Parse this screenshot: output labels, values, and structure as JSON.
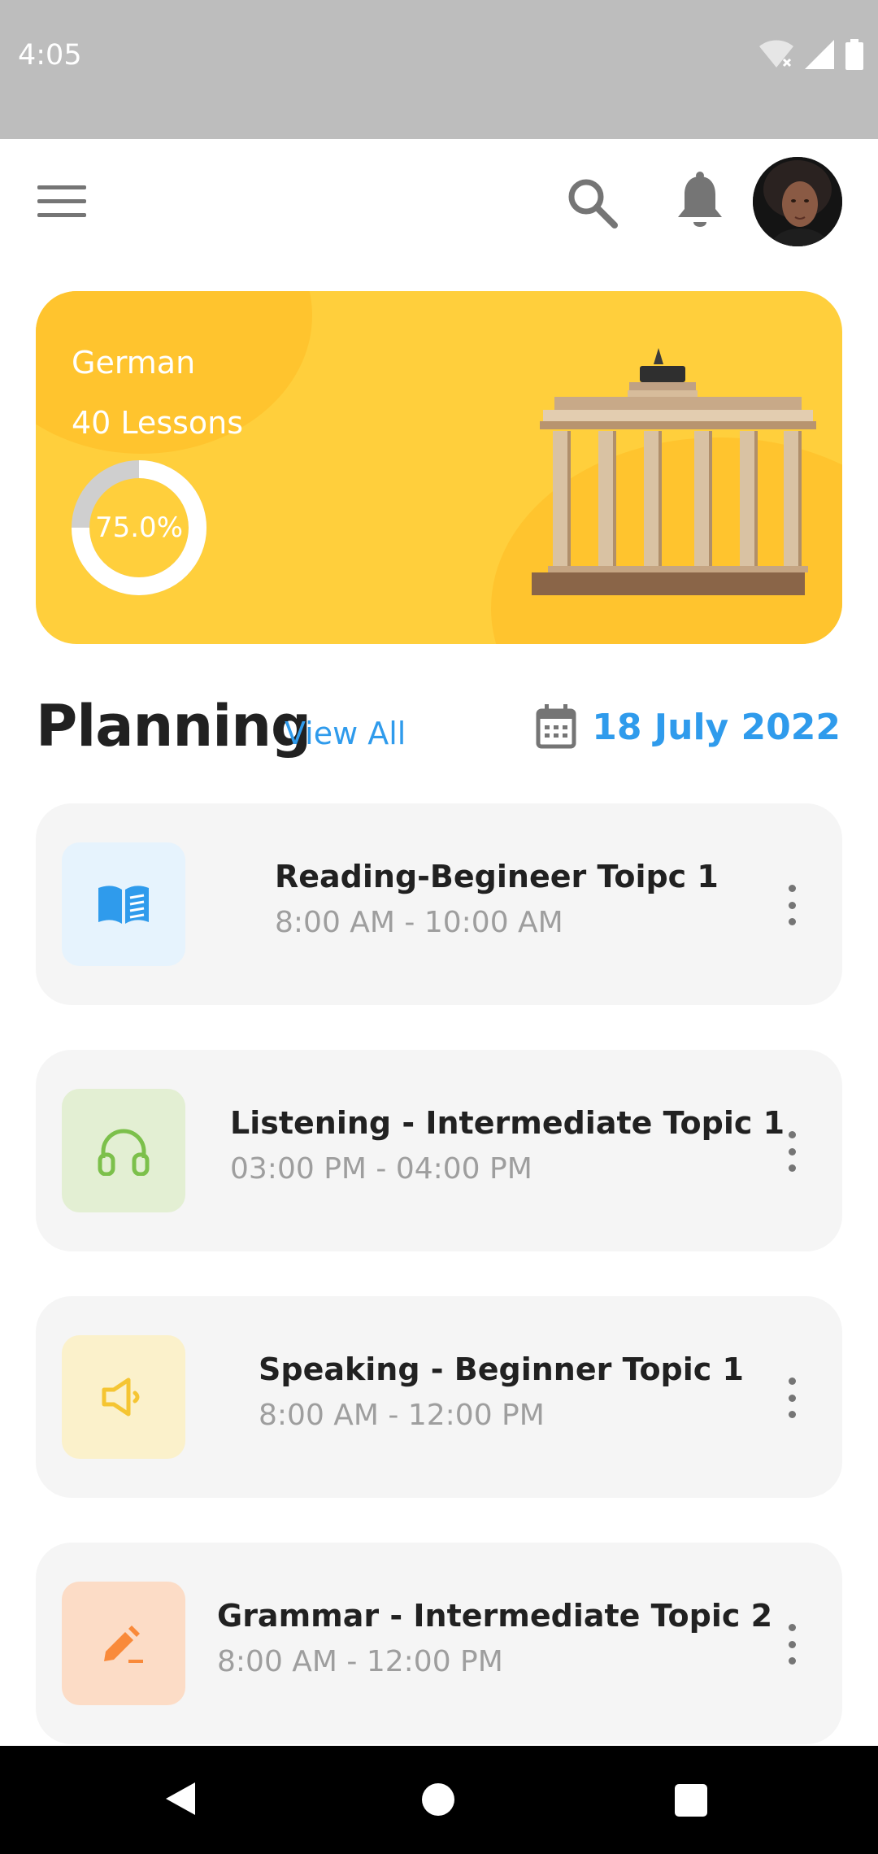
{
  "status_bar": {
    "time": "4:05"
  },
  "header": {
    "menu_icon": "hamburger-icon",
    "search_icon": "search-icon",
    "notification_icon": "bell-icon",
    "avatar": "user-avatar"
  },
  "course": {
    "title": "German",
    "lessons": "40 Lessons",
    "progress_label": "75.0%",
    "progress": 0.75,
    "colors": {
      "card": "#ffcf3c",
      "ring_track": "#c9c9c9",
      "ring_fill": "#ffffff"
    }
  },
  "planning": {
    "title": "Planning",
    "view_all": "View All",
    "date": "18 July 2022",
    "accent": "#2f9bec",
    "items": [
      {
        "title": "Reading-Begineer Toipc 1",
        "time": "8:00 AM - 10:00 AM",
        "icon": "book-icon",
        "icon_color": "#2f9bec",
        "icon_bg": "#e6f3fd"
      },
      {
        "title": "Listening - Intermediate Topic 1",
        "time": "03:00 PM - 04:00 PM",
        "icon": "headphones-icon",
        "icon_color": "#7cc04b",
        "icon_bg": "#e3efd3"
      },
      {
        "title": "Speaking - Beginner Topic 1",
        "time": "8:00 AM - 12:00 PM",
        "icon": "speaker-icon",
        "icon_color": "#f5c532",
        "icon_bg": "#fbf1cb"
      },
      {
        "title": "Grammar - Intermediate Topic 2",
        "time": "8:00 AM - 12:00 PM",
        "icon": "pencil-icon",
        "icon_color": "#f98a3a",
        "icon_bg": "#fcdcc6"
      }
    ]
  }
}
